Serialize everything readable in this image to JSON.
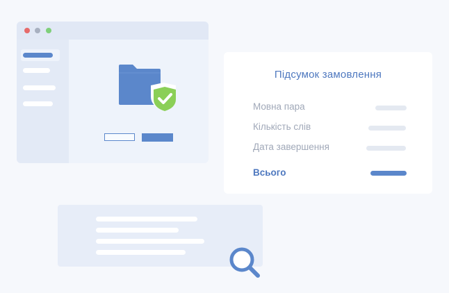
{
  "summary": {
    "title": "Підсумок замовлення",
    "rows": [
      {
        "label": "Мовна пара"
      },
      {
        "label": "Кількість слів"
      },
      {
        "label": "Дата завершення"
      }
    ],
    "total_label": "Всього"
  },
  "window_dot_colors": [
    "#e66b6b",
    "#a8b0c0",
    "#7fcf7a"
  ],
  "icons": {
    "folder": "folder-icon",
    "shield": "shield-check-icon",
    "search": "magnifier-icon"
  },
  "colors": {
    "accent": "#5b87cb",
    "shield_green": "#8bcf57",
    "text_muted": "#a0a8b8"
  }
}
